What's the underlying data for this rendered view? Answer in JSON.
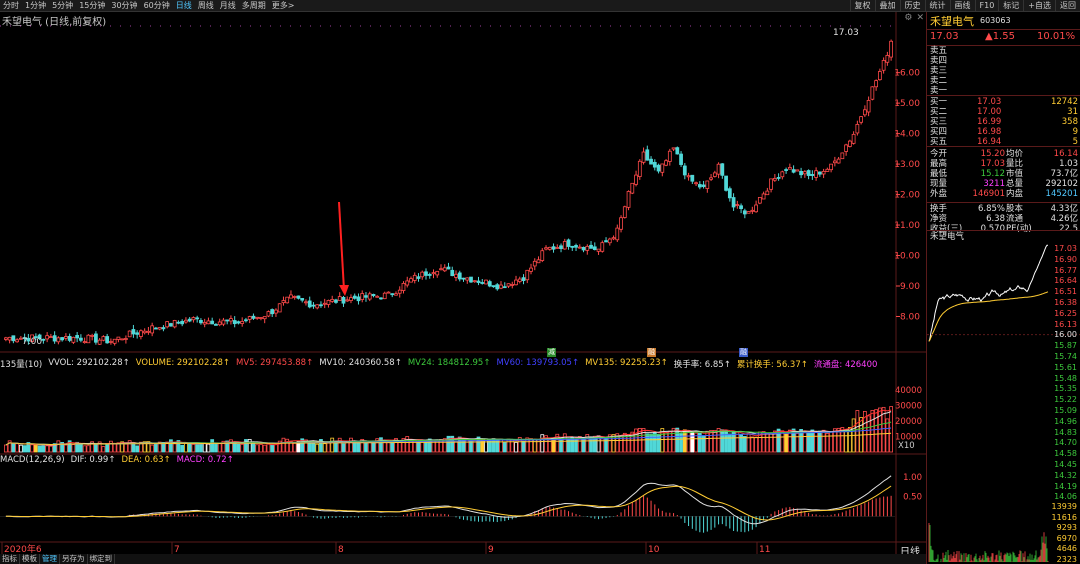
{
  "toolbar": {
    "periods": [
      "分时",
      "1分钟",
      "5分钟",
      "15分钟",
      "30分钟",
      "60分钟",
      "日线",
      "周线",
      "月线",
      "多周期",
      "更多>"
    ],
    "active_period": "日线",
    "right_buttons": [
      "叠加",
      "历史",
      "统计",
      "画线",
      "F10",
      "标记",
      "+自选",
      "返回"
    ],
    "left_button": "复权"
  },
  "chart": {
    "title": "禾望电气 (日线,前复权)",
    "high_label": "17.03",
    "low_label": "7.00",
    "y_ticks": [
      "16.00",
      "15.00",
      "14.00",
      "13.00",
      "12.00",
      "11.00",
      "10.00",
      "9.00",
      "8.00"
    ],
    "months": [
      "2020年6",
      "7",
      "8",
      "9",
      "10",
      "11"
    ],
    "period_label": "日线",
    "event_badges": [
      "减",
      "融",
      "融"
    ]
  },
  "volume": {
    "header": {
      "pre": "135量(10)",
      "vvol": "VVOL: 292102.28↑",
      "volume": "VOLUME: 292102.28↑",
      "mv5": "MV5: 297453.88↑",
      "mv10": "MV10: 240360.58↑",
      "mv24": "MV24: 184812.95↑",
      "mv60": "MV60: 139793.05↑",
      "mv135": "MV135: 92255.23↑",
      "turnover": "换手率: 6.85↑",
      "cum_turnover": "累计换手: 56.37↑",
      "float": "流通盘: 426400"
    },
    "y_ticks": [
      "40000",
      "30000",
      "20000",
      "10000"
    ],
    "unit": "X10"
  },
  "macd": {
    "header": {
      "name": "MACD(12,26,9)",
      "dif": "DIF: 0.99↑",
      "dea": "DEA: 0.63↑",
      "macd": "MACD: 0.72↑"
    },
    "y_ticks": [
      "1.00",
      "0.50"
    ]
  },
  "right_panel": {
    "name": "禾望电气",
    "code": "603063",
    "price": "17.03",
    "change": "▲1.55",
    "pct": "10.01%",
    "sells": [
      {
        "label": "卖五",
        "price": "",
        "vol": ""
      },
      {
        "label": "卖四",
        "price": "",
        "vol": ""
      },
      {
        "label": "卖三",
        "price": "",
        "vol": ""
      },
      {
        "label": "卖二",
        "price": "",
        "vol": ""
      },
      {
        "label": "卖一",
        "price": "",
        "vol": ""
      }
    ],
    "buys": [
      {
        "label": "买一",
        "price": "17.03",
        "vol": "12742"
      },
      {
        "label": "买二",
        "price": "17.00",
        "vol": "31"
      },
      {
        "label": "买三",
        "price": "16.99",
        "vol": "358"
      },
      {
        "label": "买四",
        "price": "16.98",
        "vol": "9"
      },
      {
        "label": "买五",
        "price": "16.94",
        "vol": "5"
      }
    ],
    "stats": [
      {
        "l1": "今开",
        "v1": "15.20",
        "l2": "均价",
        "v2": "16.14"
      },
      {
        "l1": "最高",
        "v1": "17.03",
        "l2": "量比",
        "v2": "1.03"
      },
      {
        "l1": "最低",
        "v1": "15.12",
        "l2": "市值",
        "v2": "73.7亿"
      },
      {
        "l1": "现量",
        "v1": "3211",
        "l2": "总量",
        "v2": "292102"
      },
      {
        "l1": "外盘",
        "v1": "146901",
        "l2": "内盘",
        "v2": "145201"
      }
    ],
    "stats2": [
      {
        "l1": "换手",
        "v1": "6.85%",
        "l2": "股本",
        "v2": "4.33亿"
      },
      {
        "l1": "净资",
        "v1": "6.38",
        "l2": "流通",
        "v2": "4.26亿"
      },
      {
        "l1": "收益(三)",
        "v1": "0.570",
        "l2": "PE(动)",
        "v2": "22.5"
      }
    ],
    "mini_title": "禾望电气",
    "mini_prices": [
      "17.03",
      "16.90",
      "16.77",
      "16.64",
      "16.51",
      "16.38",
      "16.25",
      "16.13",
      "16.00",
      "15.87",
      "15.74",
      "15.61",
      "15.48",
      "15.35",
      "15.22",
      "15.09",
      "14.96",
      "14.83",
      "14.70",
      "14.58",
      "14.45",
      "14.32",
      "14.19",
      "14.06"
    ],
    "mini_vols": [
      "13939",
      "11616",
      "9293",
      "6970",
      "4646",
      "2323"
    ]
  },
  "statusbar": [
    "指标",
    "模板",
    "管理",
    "另存为",
    "绑定到"
  ],
  "statusbar_active": "管理"
}
